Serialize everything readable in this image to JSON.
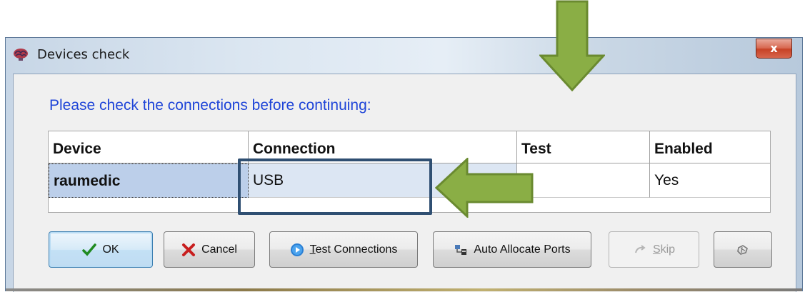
{
  "window": {
    "title": "Devices check",
    "close_label": "x"
  },
  "prompt": "Please check the connections before continuing:",
  "table": {
    "columns": [
      "Device",
      "Connection",
      "Test",
      "Enabled"
    ],
    "rows": [
      {
        "device": "raumedic",
        "connection": "USB",
        "test": "",
        "enabled": "Yes"
      }
    ]
  },
  "buttons": {
    "ok": "OK",
    "cancel": "Cancel",
    "test_connections": "Test Connections",
    "auto_allocate": "Auto Allocate Ports",
    "skip": "Skip"
  },
  "colors": {
    "annotation_arrow": "#8aae45",
    "highlight_box": "#2f4f72",
    "prompt_text": "#1f45d8"
  }
}
